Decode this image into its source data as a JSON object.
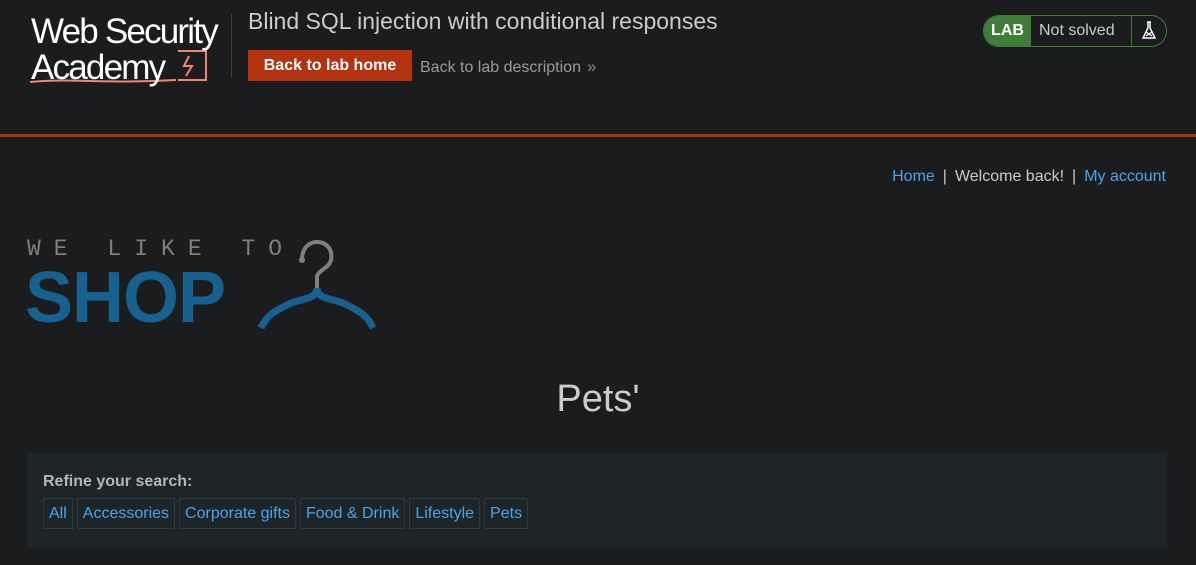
{
  "header": {
    "logo_line1": "Web Security",
    "logo_line2": "Academy",
    "lab_title": "Blind SQL injection with conditional responses",
    "back_home_label": "Back to lab home",
    "back_description_label": "Back to lab description",
    "status": {
      "tag": "LAB",
      "state": "Not solved"
    }
  },
  "nav": {
    "home": "Home",
    "separator": "|",
    "welcome": "Welcome back!",
    "my_account": "My account"
  },
  "shop_logo": {
    "top_text": "WE LIKE TO",
    "main_text": "SHOP"
  },
  "page": {
    "heading": "Pets'"
  },
  "filter": {
    "label": "Refine your search:",
    "categories": [
      "All",
      "Accessories",
      "Corporate gifts",
      "Food & Drink",
      "Lifestyle",
      "Pets"
    ]
  },
  "colors": {
    "accent_orange": "#b3330f",
    "lab_green": "#3f7d38",
    "link_blue": "#4ea2e6",
    "shop_blue": "#17618e"
  }
}
